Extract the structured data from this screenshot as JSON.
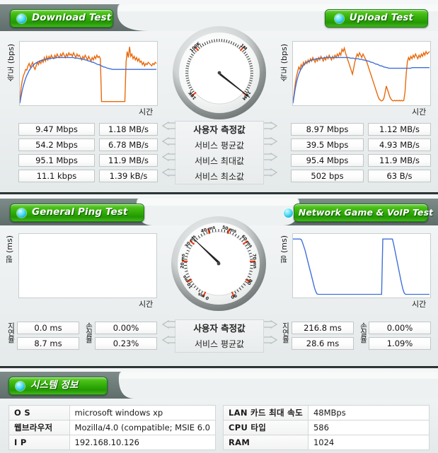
{
  "sections": {
    "download": {
      "title": "Download Test",
      "icon": "status-dot-icon"
    },
    "upload": {
      "title": "Upload Test",
      "icon": "status-dot-icon"
    },
    "ping": {
      "title": "General Ping Test",
      "icon": "status-dot-icon"
    },
    "game": {
      "title": "Network Game & VoIP Test",
      "icon": "status-dot-icon"
    },
    "system": {
      "title": "시스템 정보",
      "icon": "status-dot-icon"
    }
  },
  "axes": {
    "speed_y": "속도 (bps)",
    "ping_y": "핑 (ms)",
    "x": "시간"
  },
  "speed_legend": [
    "사용자 측정값",
    "서비스 평균값",
    "서비스 최대값",
    "서비스 최소값"
  ],
  "ping_legend": [
    "사용자 측정값",
    "서비스 평균값"
  ],
  "row_labels": {
    "latency": "지연율",
    "loss": "손실율"
  },
  "download_values": {
    "bps": [
      "9.47 Mbps",
      "54.2 Mbps",
      "95.1 Mbps",
      "11.1 kbps"
    ],
    "bytes": [
      "1.18 MB/s",
      "6.78 MB/s",
      "11.9 MB/s",
      "1.39 kB/s"
    ]
  },
  "upload_values": {
    "bps": [
      "8.97 Mbps",
      "39.5 Mbps",
      "95.4 Mbps",
      "502 bps"
    ],
    "bytes": [
      "1.12 MB/s",
      "4.93 MB/s",
      "11.9 MB/s",
      "63 B/s"
    ]
  },
  "ping_values": {
    "latency": [
      "0.0 ms",
      "8.7 ms"
    ],
    "loss": [
      "0.00%",
      "0.23%"
    ]
  },
  "game_values": {
    "latency": [
      "216.8 ms",
      "28.6 ms"
    ],
    "loss": [
      "0.00%",
      "1.09%"
    ]
  },
  "system_info": {
    "left": [
      {
        "key": "O S",
        "value": "microsoft windows xp"
      },
      {
        "key": "웹브라우저",
        "value": "Mozilla/4.0 (compatible; MSIE 6.0"
      },
      {
        "key": "I P",
        "value": "192.168.10.126"
      }
    ],
    "right": [
      {
        "key": "LAN 카드 최대 속도",
        "value": "48MBps"
      },
      {
        "key": "CPU 타입",
        "value": "586"
      },
      {
        "key": "RAM",
        "value": "1024"
      }
    ]
  },
  "colors": {
    "user_series": "#e8690b",
    "service_series": "#3f6fd8",
    "tab_green": "#2faa07",
    "dot_cyan": "#18b8dc"
  },
  "chart_data": [
    {
      "id": "download-graph",
      "type": "line",
      "title": "Download Test",
      "xlabel": "시간",
      "ylabel": "속도 (bps)",
      "grid": false,
      "legend": "none",
      "series": [
        {
          "name": "사용자 측정값",
          "color": "#e8690b",
          "values": [
            2,
            26,
            38,
            47,
            52,
            58,
            57,
            64,
            68,
            62,
            66,
            70,
            62,
            58,
            64,
            70,
            66,
            72,
            68,
            74,
            70,
            78,
            72,
            80,
            74,
            80,
            76,
            82,
            78,
            76,
            82,
            78,
            84,
            80,
            78,
            84,
            80,
            86,
            82,
            78,
            84,
            80,
            86,
            82,
            84,
            80,
            86,
            82,
            78,
            84,
            80,
            82,
            78,
            74,
            80,
            76,
            82,
            78,
            74,
            80,
            76,
            72,
            78,
            74,
            80,
            76,
            82,
            78,
            80,
            76,
            4,
            4,
            4,
            4,
            4,
            4,
            4,
            4,
            4,
            4,
            4,
            4,
            4,
            4,
            4,
            4,
            4,
            4,
            4,
            4,
            4,
            70,
            88,
            78,
            96,
            80,
            84,
            76,
            80,
            74,
            78,
            72,
            76,
            70,
            72,
            66,
            70,
            64,
            68,
            66,
            70,
            68,
            66,
            64,
            68,
            66,
            70,
            68
          ]
        },
        {
          "name": "서비스 평균값",
          "color": "#3f6fd8",
          "values": [
            1,
            12,
            22,
            30,
            37,
            43,
            48,
            52,
            56,
            59,
            62,
            64,
            66,
            68,
            69,
            70,
            71,
            72,
            73,
            73,
            74,
            74,
            75,
            75,
            76,
            76,
            76,
            77,
            77,
            77,
            77,
            78,
            78,
            78,
            78,
            78,
            78,
            78,
            78,
            78,
            78,
            78,
            78,
            78,
            78,
            78,
            78,
            77,
            77,
            77,
            77,
            76,
            76,
            76,
            75,
            75,
            74,
            74,
            73,
            72,
            72,
            71,
            70,
            70,
            69,
            68,
            67,
            66,
            66,
            65,
            64,
            63,
            62,
            62,
            61,
            60,
            60,
            59,
            59,
            58,
            58,
            58,
            58,
            58,
            58,
            58,
            58,
            58,
            58,
            58,
            58,
            58,
            58,
            58,
            58,
            58,
            58,
            58,
            58,
            58,
            58,
            58,
            58,
            58,
            58,
            58,
            58,
            58,
            58,
            58,
            58,
            58,
            58,
            58,
            58,
            58,
            58,
            58
          ]
        }
      ]
    },
    {
      "id": "upload-graph",
      "type": "line",
      "title": "Upload Test",
      "xlabel": "시간",
      "ylabel": "속도 (bps)",
      "grid": false,
      "legend": "none",
      "series": [
        {
          "name": "사용자 측정값",
          "color": "#e8690b",
          "values": [
            2,
            18,
            34,
            46,
            54,
            62,
            58,
            66,
            62,
            70,
            66,
            72,
            68,
            74,
            70,
            76,
            72,
            78,
            74,
            70,
            76,
            72,
            78,
            74,
            80,
            76,
            72,
            78,
            74,
            80,
            76,
            82,
            78,
            74,
            80,
            76,
            82,
            78,
            84,
            80,
            86,
            82,
            92,
            88,
            94,
            86,
            80,
            74,
            68,
            62,
            56,
            50,
            60,
            70,
            78,
            84,
            80,
            86,
            82,
            78,
            84,
            80,
            76,
            72,
            66,
            60,
            54,
            48,
            42,
            36,
            30,
            24,
            18,
            12,
            8,
            6,
            5,
            6,
            10,
            20,
            30,
            24,
            18,
            12,
            8,
            6,
            5,
            6,
            5,
            6,
            5,
            6,
            5,
            6,
            5,
            6,
            20,
            50,
            70,
            78,
            74,
            80,
            76,
            82,
            78,
            84,
            80,
            76,
            82,
            78,
            84,
            80,
            86,
            82,
            88,
            84,
            86,
            88
          ]
        },
        {
          "name": "서비스 평균값",
          "color": "#3f6fd8",
          "values": [
            1,
            14,
            26,
            36,
            44,
            50,
            55,
            59,
            62,
            65,
            67,
            69,
            70,
            71,
            72,
            73,
            74,
            74,
            75,
            75,
            76,
            76,
            76,
            77,
            77,
            77,
            77,
            78,
            78,
            78,
            78,
            78,
            78,
            78,
            78,
            78,
            78,
            78,
            78,
            78,
            78,
            78,
            78,
            78,
            78,
            78,
            78,
            78,
            78,
            77,
            77,
            77,
            77,
            76,
            76,
            76,
            76,
            75,
            75,
            75,
            74,
            74,
            73,
            73,
            72,
            72,
            71,
            70,
            70,
            69,
            68,
            67,
            67,
            66,
            65,
            64,
            64,
            63,
            62,
            62,
            61,
            61,
            60,
            60,
            60,
            60,
            60,
            60,
            60,
            60,
            60,
            60,
            60,
            60,
            60,
            60,
            60,
            60,
            60,
            60,
            60,
            60,
            61,
            61,
            61,
            61,
            61,
            61,
            61,
            61,
            61,
            61,
            61,
            61,
            61,
            61,
            61,
            61
          ]
        }
      ]
    },
    {
      "id": "ping-graph",
      "type": "line",
      "title": "General Ping Test",
      "xlabel": "시간",
      "ylabel": "핑 (ms)",
      "grid": false,
      "legend": "none",
      "series": []
    },
    {
      "id": "game-graph",
      "type": "line",
      "title": "Network Game & VoIP Test",
      "xlabel": "시간",
      "ylabel": "핑 (ms)",
      "grid": false,
      "legend": "none",
      "series": [
        {
          "name": "사용자 측정값",
          "color": "#3f6fd8",
          "values": [
            96,
            96,
            96,
            96,
            96,
            96,
            96,
            95,
            90,
            84,
            78,
            70,
            62,
            54,
            46,
            38,
            30,
            22,
            14,
            8,
            4,
            3,
            3,
            3,
            3,
            3,
            3,
            3,
            3,
            3,
            3,
            3,
            3,
            3,
            3,
            3,
            3,
            3,
            3,
            3,
            3,
            3,
            3,
            3,
            3,
            3,
            3,
            3,
            3,
            3,
            3,
            3,
            3,
            3,
            3,
            3,
            3,
            3,
            3,
            3,
            3,
            3,
            3,
            3,
            3,
            3,
            3,
            3,
            3,
            3,
            3,
            3,
            3,
            3,
            3,
            96,
            96,
            96,
            96,
            96,
            96,
            96,
            96,
            96,
            88,
            78,
            68,
            58,
            48,
            38,
            28,
            18,
            10,
            5,
            3,
            3,
            3,
            3,
            3,
            3,
            3,
            3,
            3,
            3,
            3,
            3,
            3,
            3,
            3,
            3,
            3,
            3,
            3,
            3,
            3
          ]
        }
      ]
    }
  ],
  "gauges": [
    {
      "id": "speed-gauge",
      "unit": "bps",
      "major_ticks": [
        "10K",
        "100K",
        "1M",
        "10M"
      ],
      "needle_value": "10M"
    },
    {
      "id": "ping-gauge",
      "unit": "ms",
      "major_ticks": [
        "0 ms",
        "10 ms",
        "20 ms",
        "30 ms",
        "40 ms",
        "50 ms",
        "60 ms",
        "70 ms",
        "80",
        "90"
      ],
      "needle_value": "30 ms"
    }
  ]
}
